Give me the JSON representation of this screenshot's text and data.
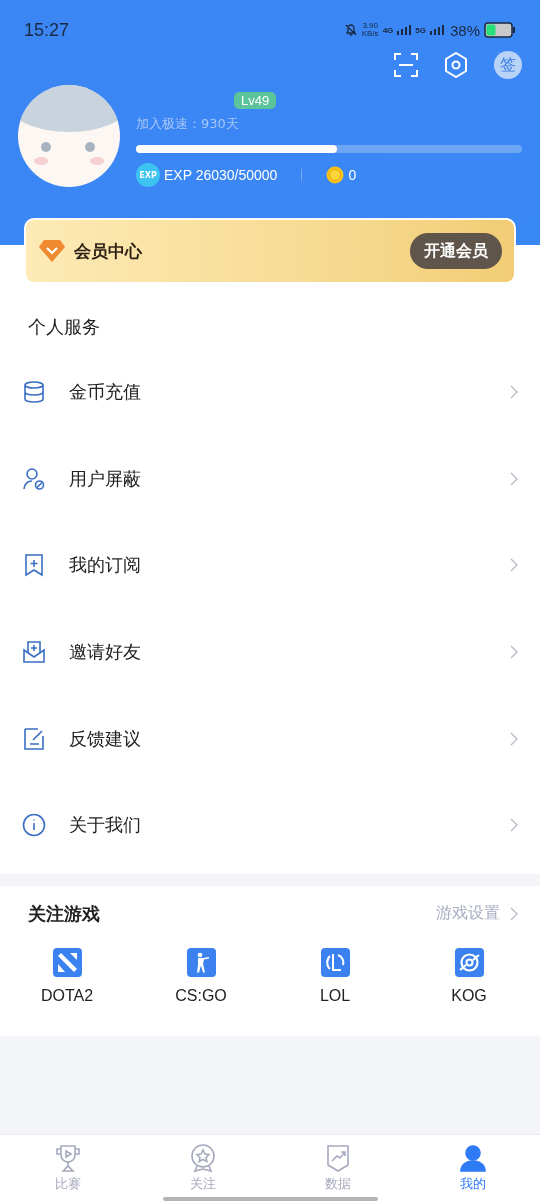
{
  "status_bar": {
    "time": "15:27",
    "speed": "3.90",
    "speed_unit": "KB/s",
    "network_1": "4G",
    "network_2": "5G",
    "battery": "38%"
  },
  "header": {
    "sign_in": "签"
  },
  "profile": {
    "level_badge": "Lv49",
    "joined": "加入极速：930天",
    "exp_progress": {
      "level": 0.52
    },
    "exp_label": "EXP",
    "exp": "EXP 26030/50000",
    "coins": "0"
  },
  "vip_card": {
    "title": "会员中心",
    "button": "开通会员"
  },
  "personal_services": {
    "title": "个人服务",
    "items": [
      {
        "kind": "coins",
        "label": "金币充值"
      },
      {
        "kind": "block",
        "label": "用户屏蔽"
      },
      {
        "kind": "subscribe",
        "label": "我的订阅"
      },
      {
        "kind": "invite",
        "label": "邀请好友"
      },
      {
        "kind": "feedback",
        "label": "反馈建议"
      },
      {
        "kind": "about",
        "label": "关于我们"
      }
    ]
  },
  "followed_games": {
    "title": "关注游戏",
    "settings_link": "游戏设置",
    "games": [
      {
        "kind": "dota",
        "label": "DOTA2"
      },
      {
        "kind": "csgo",
        "label": "CS:GO"
      },
      {
        "kind": "lol",
        "label": "LOL"
      },
      {
        "kind": "kog",
        "label": "KOG"
      }
    ]
  },
  "tab_bar": [
    {
      "kind": "match",
      "label": "比赛",
      "selected": false
    },
    {
      "kind": "follow",
      "label": "关注",
      "selected": false
    },
    {
      "kind": "data",
      "label": "数据",
      "selected": false
    },
    {
      "kind": "me",
      "label": "我的",
      "selected": true
    }
  ]
}
